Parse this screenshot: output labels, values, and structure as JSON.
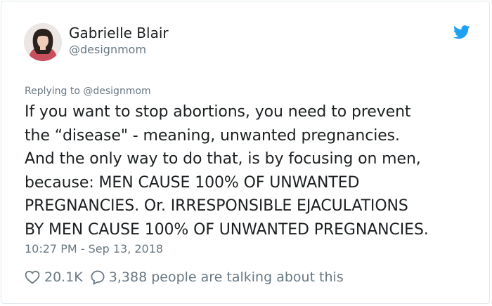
{
  "author": {
    "name": "Gabrielle Blair",
    "handle": "@designmom"
  },
  "replying_to": "Replying to @designmom",
  "tweet": {
    "lines": [
      "If you want to stop abortions, you need to prevent",
      "the “disease\" - meaning, unwanted pregnancies.",
      "And the only way to do that, is by focusing on men,",
      "because: MEN CAUSE 100% OF UNWANTED",
      "PREGNANCIES. Or. IRRESPONSIBLE EJACULATIONS",
      "BY MEN CAUSE 100% OF UNWANTED PREGNANCIES."
    ]
  },
  "timestamp": "10:27 PM - Sep 13, 2018",
  "actions": {
    "likes": "20.1K",
    "talking": "3,388 people are talking about this"
  },
  "icons": {
    "brand": "twitter-bird-icon",
    "like": "heart-icon",
    "reply": "speech-bubble-icon"
  },
  "colors": {
    "brand": "#1da1f2",
    "text": "#1c2022",
    "secondary": "#697882",
    "border": "#e1e8ed"
  }
}
